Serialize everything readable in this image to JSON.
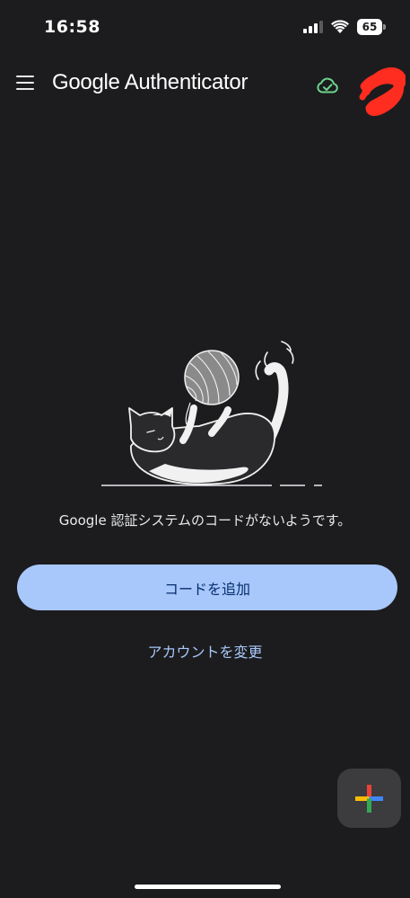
{
  "status_bar": {
    "time": "16:58",
    "battery_level": "65",
    "icons": [
      "cellular-signal-icon",
      "wifi-icon",
      "battery-icon"
    ]
  },
  "app_bar": {
    "title": "Google Authenticator",
    "icons": [
      "menu-icon",
      "cloud-sync-icon"
    ],
    "sync_status_color": "#6dd58c",
    "avatar_redaction_color": "#ff2d20"
  },
  "empty_state": {
    "illustration": "cat-playing-with-yarn",
    "message": "Google 認証システムのコードがないようです。"
  },
  "actions": {
    "add_code_label": "コードを追加",
    "switch_account_label": "アカウントを変更"
  },
  "fab": {
    "icon": "google-plus-icon",
    "colors": [
      "#ea4335",
      "#4285f4",
      "#fbbc04",
      "#34a853"
    ]
  },
  "theme": {
    "background": "#1c1c1e",
    "primary_button": "#a8c7fa",
    "primary_button_text": "#062e6f",
    "link": "#a8c7fa"
  }
}
